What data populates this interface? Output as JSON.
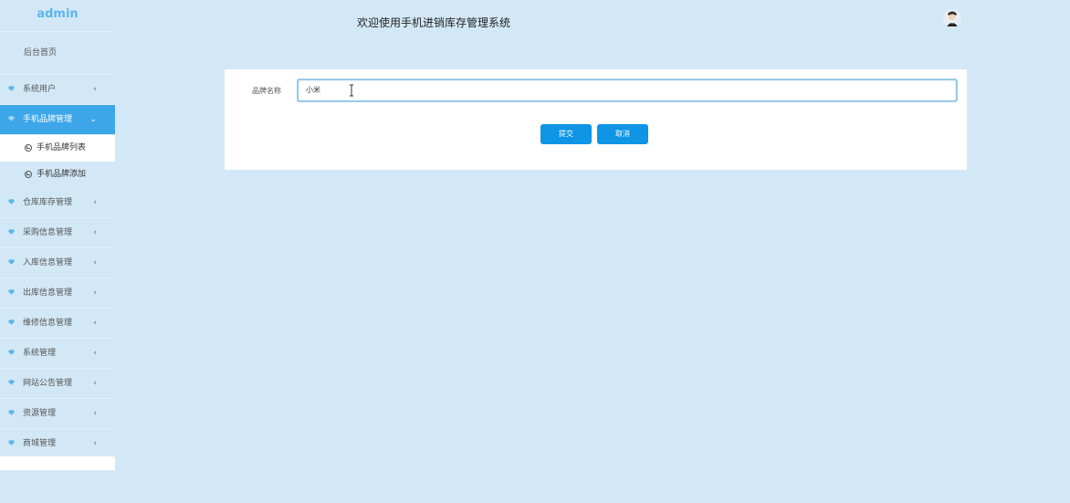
{
  "sidebar": {
    "brand": "admin",
    "home": "后台首页",
    "items": [
      {
        "label": "系统用户",
        "expanded": false
      },
      {
        "label": "手机品牌管理",
        "expanded": true,
        "children": [
          {
            "label": "手机品牌列表"
          },
          {
            "label": "手机品牌添加"
          }
        ]
      },
      {
        "label": "仓库库存管理",
        "expanded": false
      },
      {
        "label": "采购信息管理",
        "expanded": false
      },
      {
        "label": "入库信息管理",
        "expanded": false
      },
      {
        "label": "出库信息管理",
        "expanded": false
      },
      {
        "label": "维修信息管理",
        "expanded": false
      },
      {
        "label": "系统管理",
        "expanded": false
      },
      {
        "label": "网站公告管理",
        "expanded": false
      },
      {
        "label": "资源管理",
        "expanded": false
      },
      {
        "label": "商城管理",
        "expanded": false
      }
    ],
    "chevron_collapsed": "‹",
    "chevron_expanded": "⌄"
  },
  "header": {
    "title": "欢迎使用手机进销库存管理系统"
  },
  "form": {
    "brand_name_label": "品牌名称",
    "brand_name_value": "小米",
    "submit_label": "提交",
    "cancel_label": "取消"
  },
  "colors": {
    "background": "#d3e8f6",
    "accent": "#3da6e8",
    "button": "#0e95e6",
    "brand": "#5bb6ea"
  }
}
